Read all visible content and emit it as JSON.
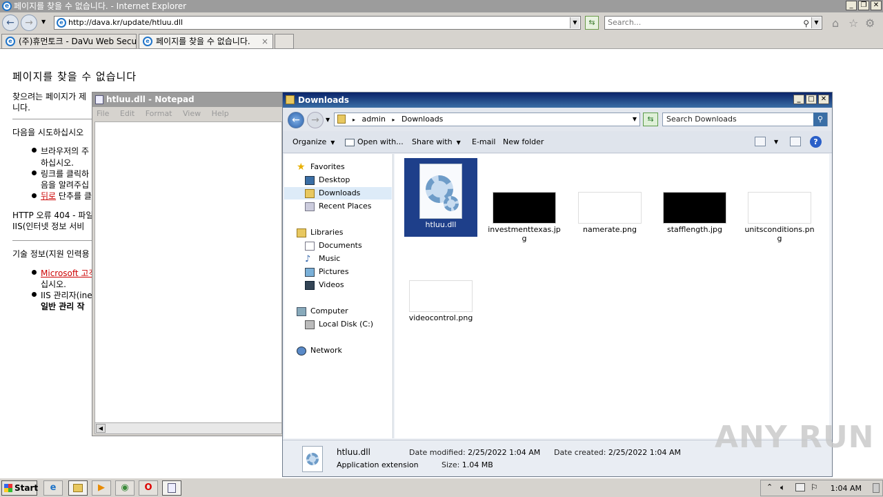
{
  "ie": {
    "title": "페이지를 찾을 수 없습니다. - Internet Explorer",
    "address": "http://dava.kr/update/htluu.dll",
    "search_placeholder": "Search...",
    "tabs": [
      {
        "label": "(주)휴먼토크 - DaVu Web Secu..."
      },
      {
        "label": "페이지를 찾을 수 없습니다.",
        "close": "×"
      }
    ]
  },
  "page": {
    "heading": "페이지를 찾을 수 없습니다",
    "lines": {
      "p1a": "찾으려는 페이지가 제",
      "p1b": "니다.",
      "try": "다음을 시도하십시오",
      "b1a": "브라우저의 주",
      "b1b": "하십시오.",
      "b2a": "링크를 클릭하",
      "b2b": "음을 알려주십",
      "b3_link": "뒤로",
      "b3_rest": " 단추를 클",
      "http": "HTTP 오류 404 - 파일",
      "iis": "IIS(인터넷 정보 서비",
      "tech": "기술 정보(지원 인력용",
      "t1_link": "Microsoft 고객",
      "t1b": "십시오.",
      "t2a": "IIS 관리자(ine",
      "t2b": "일반 관리 작"
    }
  },
  "notepad": {
    "title": "htluu.dll - Notepad",
    "menu": [
      "File",
      "Edit",
      "Format",
      "View",
      "Help"
    ],
    "content": ""
  },
  "explorer": {
    "title": "Downloads",
    "breadcrumb": [
      "admin",
      "Downloads"
    ],
    "search_placeholder": "Search Downloads",
    "toolbar": {
      "organize": "Organize",
      "open_with": "Open with...",
      "share_with": "Share with",
      "email": "E-mail",
      "new_folder": "New folder"
    },
    "nav": {
      "favorites": "Favorites",
      "desktop": "Desktop",
      "downloads": "Downloads",
      "recent": "Recent Places",
      "libraries": "Libraries",
      "documents": "Documents",
      "music": "Music",
      "pictures": "Pictures",
      "videos": "Videos",
      "computer": "Computer",
      "localdisk": "Local Disk (C:)",
      "network": "Network"
    },
    "files": [
      {
        "name": "htluu.dll",
        "kind": "dll",
        "selected": true
      },
      {
        "name": "investmenttexas.jpg",
        "kind": "dark"
      },
      {
        "name": "namerate.png",
        "kind": "white"
      },
      {
        "name": "stafflength.jpg",
        "kind": "dark"
      },
      {
        "name": "unitsconditions.png",
        "kind": "white"
      },
      {
        "name": "videocontrol.png",
        "kind": "white"
      }
    ],
    "details": {
      "name": "htluu.dll",
      "type": "Application extension",
      "modified_label": "Date modified:",
      "modified": "2/25/2022 1:04 AM",
      "size_label": "Size:",
      "size": "1.04 MB",
      "created_label": "Date created:",
      "created": "2/25/2022 1:04 AM"
    }
  },
  "taskbar": {
    "start": "Start",
    "clock": "1:04 AM"
  },
  "watermark": "ANY RUN"
}
